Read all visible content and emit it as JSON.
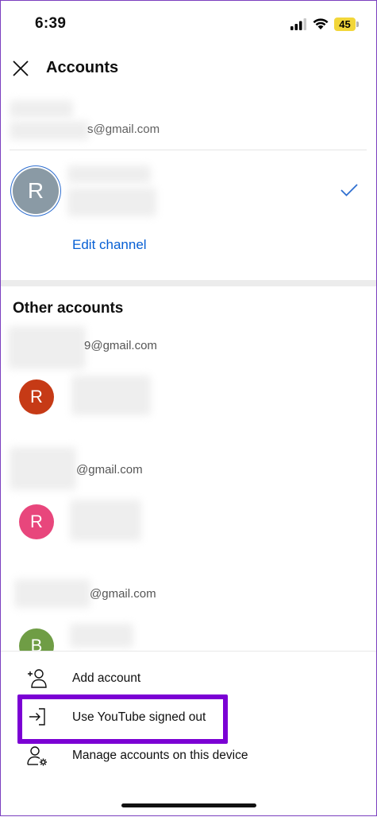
{
  "status_bar": {
    "time": "6:39",
    "battery": "45",
    "icons": [
      "signal-icon",
      "wifi-icon",
      "battery-icon"
    ]
  },
  "header": {
    "title": "Accounts",
    "close_icon": "close-icon"
  },
  "current_account": {
    "email": "s@gmail.com",
    "avatar_letter": "R",
    "selected_icon": "checkmark-icon",
    "edit_channel_label": "Edit channel"
  },
  "other_accounts": {
    "title": "Other accounts",
    "items": [
      {
        "email": "9@gmail.com",
        "avatar_letter": "R",
        "avatar_color": "#c63a16"
      },
      {
        "email": "@gmail.com",
        "avatar_letter": "R",
        "avatar_color": "#e8467c"
      },
      {
        "email": "@gmail.com",
        "avatar_letter": "B",
        "avatar_color": "#6f9d45"
      }
    ]
  },
  "menu": {
    "add_account": {
      "label": "Add account",
      "icon": "add-person-icon"
    },
    "signed_out": {
      "label": "Use YouTube signed out",
      "icon": "sign-in-arrow-icon"
    },
    "manage": {
      "label": "Manage accounts on this device",
      "icon": "person-gear-icon"
    }
  },
  "colors": {
    "accent": "#065fd4",
    "highlight": "#7b00d4"
  }
}
